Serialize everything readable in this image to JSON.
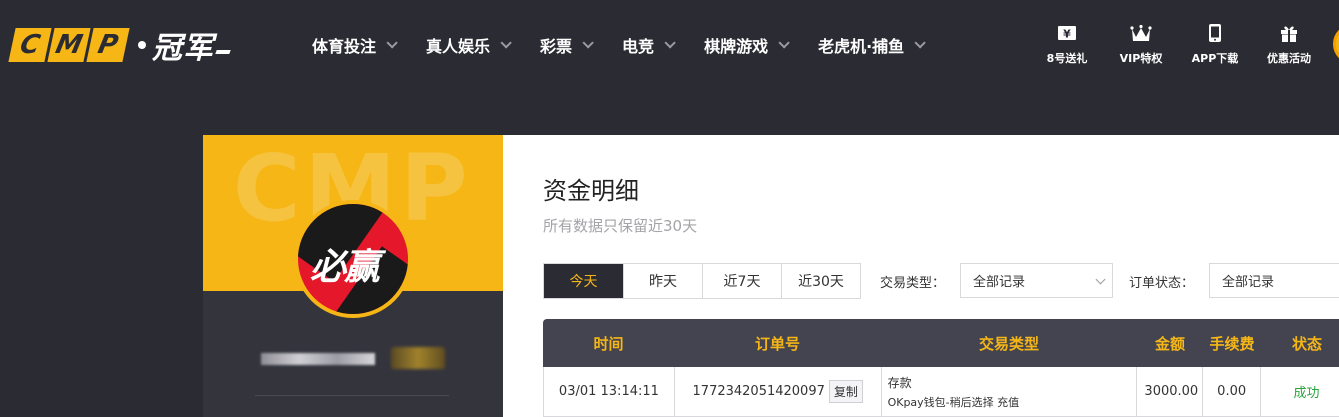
{
  "header": {
    "logo": {
      "letters": [
        "C",
        "M",
        "P"
      ],
      "brand_cn": "冠军"
    },
    "nav": [
      {
        "label": "体育投注"
      },
      {
        "label": "真人娱乐"
      },
      {
        "label": "彩票"
      },
      {
        "label": "电竞"
      },
      {
        "label": "棋牌游戏"
      },
      {
        "label": "老虎机·捕鱼"
      }
    ],
    "quick_links": [
      {
        "label": "8号送礼",
        "icon": "yen-ticket-icon"
      },
      {
        "label": "VIP特权",
        "icon": "crown-icon"
      },
      {
        "label": "APP下载",
        "icon": "phone-icon"
      },
      {
        "label": "优惠活动",
        "icon": "gift-icon"
      }
    ]
  },
  "profile": {
    "watermark": "CMP",
    "avatar_text": "必赢"
  },
  "main": {
    "title": "资金明细",
    "subtitle": "所有数据只保留近30天",
    "range_tabs": [
      {
        "label": "今天",
        "active": true
      },
      {
        "label": "昨天",
        "active": false
      },
      {
        "label": "近7天",
        "active": false
      },
      {
        "label": "近30天",
        "active": false
      }
    ],
    "filters": {
      "type_label": "交易类型：",
      "type_value": "全部记录",
      "status_label": "订单状态：",
      "status_value": "全部记录"
    },
    "table": {
      "columns": [
        "时间",
        "订单号",
        "交易类型",
        "金额",
        "手续费",
        "状态"
      ],
      "rows": [
        {
          "time": "03/01 13:14:11",
          "order_no": "1772342051420097",
          "copy_label": "复制",
          "type_main": "存款",
          "type_sub": "OKpay钱包-稍后选择 充值",
          "amount": "3000.00",
          "fee": "0.00",
          "status": "成功"
        }
      ]
    }
  },
  "colors": {
    "accent": "#f5b616",
    "header_bg": "#2b2b33",
    "table_head_bg": "#444450",
    "success": "#29a33b"
  }
}
